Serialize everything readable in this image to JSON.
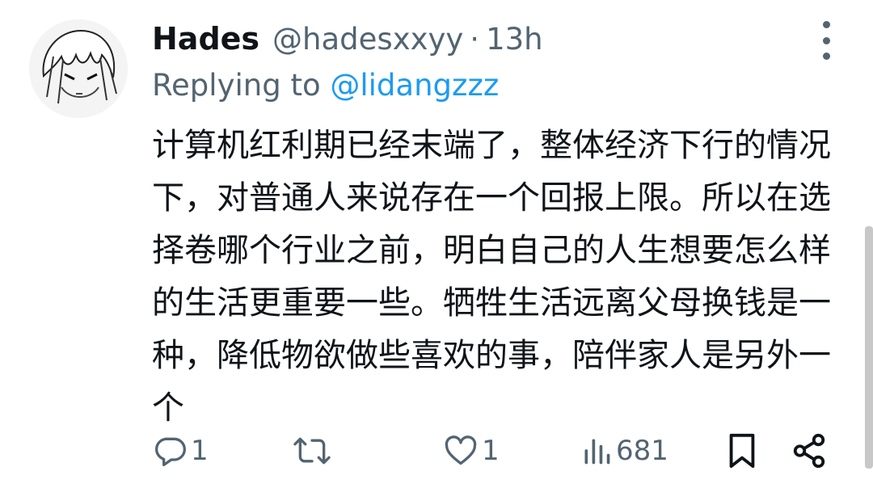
{
  "author": {
    "name": "Hades",
    "handle": "@hadesxxyy",
    "separator": "·",
    "time": "13h"
  },
  "reply": {
    "prefix": "Replying to",
    "mention": "@lidangzzz"
  },
  "tweet": {
    "text": "计算机红利期已经末端了，整体经济下行的情况下，对普通人来说存在一个回报上限。所以在选择卷哪个行业之前，明白自己的人生想要怎么样的生活更重要一些。牺牲生活远离父母换钱是一种，降低物欲做些喜欢的事，陪伴家人是另外一个"
  },
  "actions": {
    "reply_count": "1",
    "retweet_count": "",
    "like_count": "1",
    "views_count": "681"
  },
  "icons": {
    "avatar": "anime-avatar",
    "more": "more-vertical-icon",
    "reply": "reply-icon",
    "retweet": "retweet-icon",
    "like": "heart-icon",
    "views": "views-icon",
    "bookmark": "bookmark-icon",
    "share": "share-icon"
  },
  "colors": {
    "text": "#0f1419",
    "secondary": "#536471",
    "link": "#1d9bf0"
  }
}
